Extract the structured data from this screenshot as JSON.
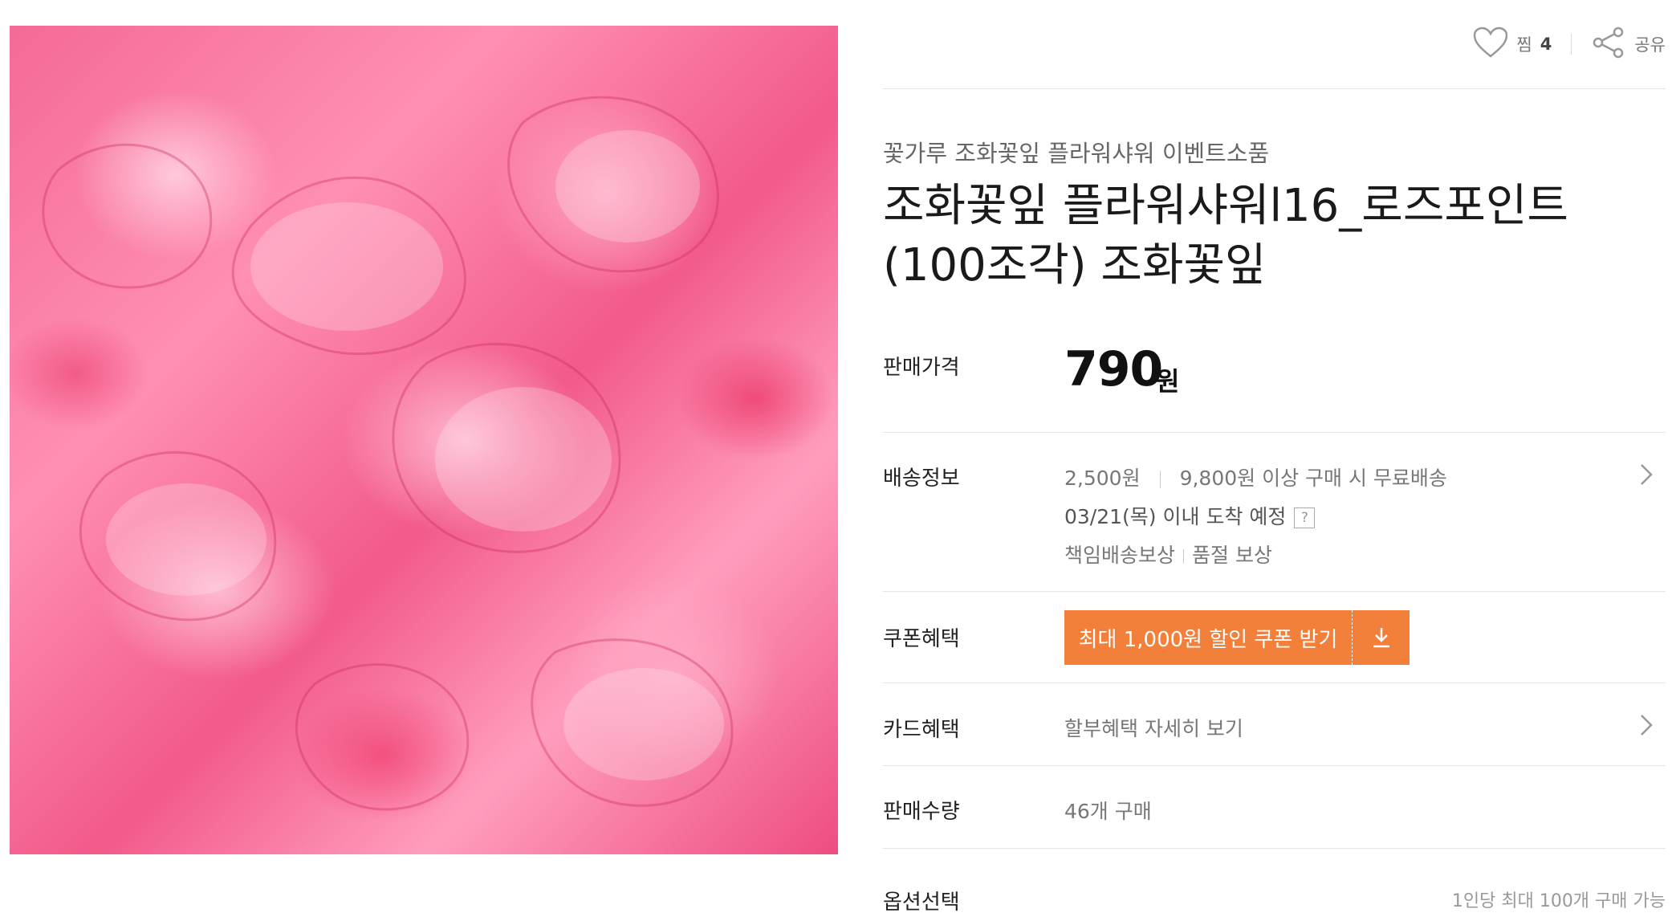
{
  "product_image": {
    "alt": "조화꽃잎 플라워샤워"
  },
  "actions": {
    "wish_label": "찜",
    "wish_count": "4",
    "share_label": "공유"
  },
  "product": {
    "category": "꽃가루 조화꽃잎 플라워샤워 이벤트소품",
    "title": "조화꽃잎 플라워샤워l16_로즈포인트 (100조각) 조화꽃잎"
  },
  "price": {
    "label": "판매가격",
    "value": "790",
    "unit": "원"
  },
  "shipping": {
    "label": "배송정보",
    "fee": "2,500원",
    "free_condition": "9,800원 이상 구매 시 무료배송",
    "arrival": "03/21(목) 이내 도착 예정",
    "help_icon": "?",
    "guarantee_1": "책임배송보상",
    "guarantee_2": "품절 보상"
  },
  "coupon": {
    "label": "쿠폰혜택",
    "button_label": "최대 1,000원 할인 쿠폰 받기",
    "button_color": "#f2803a"
  },
  "card": {
    "label": "카드혜택",
    "link": "할부혜택 자세히 보기"
  },
  "sales": {
    "label": "판매수량",
    "value": "46개 구매"
  },
  "options": {
    "label": "옵션선택",
    "limit_text": "1인당 최대 100개 구매 가능"
  }
}
